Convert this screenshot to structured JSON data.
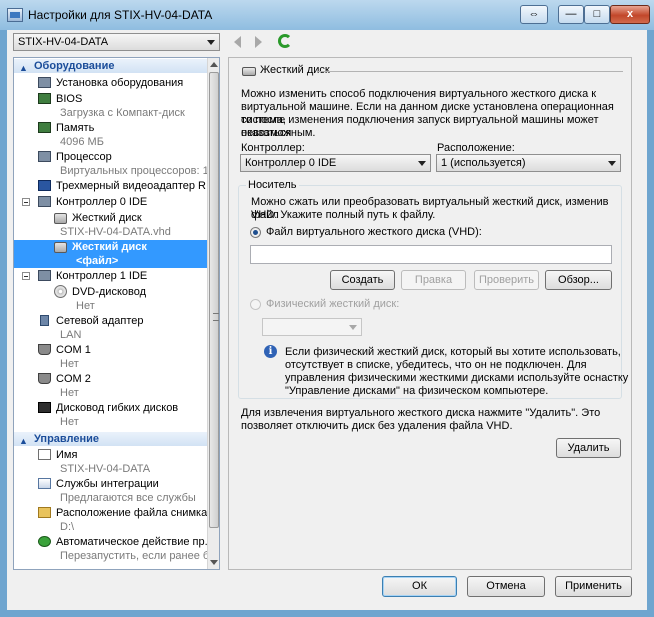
{
  "window": {
    "title": "Настройки для STIX-HV-04-DATA",
    "close_glyph": "x",
    "min_glyph": "—",
    "max_glyph": "□"
  },
  "vm_selector": {
    "value": "STIX-HV-04-DATA"
  },
  "tree": {
    "hardware_header": "Оборудование",
    "management_header": "Управление",
    "items": [
      {
        "label": "Установка оборудования",
        "sub": ""
      },
      {
        "label": "BIOS",
        "sub": "Загрузка с Компакт-диск"
      },
      {
        "label": "Память",
        "sub": "4096 МБ"
      },
      {
        "label": "Процессор",
        "sub": "Виртуальных процессоров: 1"
      },
      {
        "label": "Трехмерный видеоадаптер R...",
        "sub": ""
      },
      {
        "label": "Контроллер 0 IDE",
        "sub": ""
      },
      {
        "label": "Жесткий диск",
        "sub": "STIX-HV-04-DATA.vhd"
      },
      {
        "label": "Жесткий диск",
        "sub": "<файл>"
      },
      {
        "label": "Контроллер 1 IDE",
        "sub": ""
      },
      {
        "label": "DVD-дисковод",
        "sub": "Нет"
      },
      {
        "label": "Сетевой адаптер",
        "sub": "LAN"
      },
      {
        "label": "COM 1",
        "sub": "Нет"
      },
      {
        "label": "COM 2",
        "sub": "Нет"
      },
      {
        "label": "Дисковод гибких дисков",
        "sub": "Нет"
      }
    ],
    "mgmt_items": [
      {
        "label": "Имя",
        "sub": "STIX-HV-04-DATA"
      },
      {
        "label": "Службы интеграции",
        "sub": "Предлагаются все службы"
      },
      {
        "label": "Расположение файла снимка",
        "sub": "D:\\"
      },
      {
        "label": "Автоматическое действие пр...",
        "sub": "Перезапустить, если ранее б..."
      }
    ]
  },
  "panel": {
    "title": "Жесткий диск",
    "intro": [
      "Можно изменить способ подключения виртуального жесткого диска к",
      "виртуальной машине. Если на данном диске установлена операционная система,",
      "то после изменения подключения запуск виртуальной машины может оказаться",
      "невозможным."
    ],
    "controller_label": "Контроллер:",
    "controller_value": "Контроллер 0 IDE",
    "location_label": "Расположение:",
    "location_value": "1 (используется)",
    "media_label": "Носитель",
    "media_desc": [
      "Можно сжать или преобразовать виртуальный жесткий диск, изменив файл",
      "VHD. Укажите полный путь к файлу."
    ],
    "vhd_radio": "Файл виртуального жесткого диска (VHD):",
    "vhd_value": "",
    "btn_create": "Создать",
    "btn_edit": "Правка",
    "btn_inspect": "Проверить",
    "btn_browse": "Обзор...",
    "physical_radio": "Физический жесткий диск:",
    "info": [
      "Если физический жесткий диск, который вы хотите использовать,",
      "отсутствует в списке, убедитесь, что он не подключен. Для",
      "управления физическими жесткими дисками используйте оснастку",
      "\"Управление дисками\" на физическом компьютере."
    ],
    "remove_text": [
      "Для извлечения виртуального жесткого диска нажмите \"Удалить\". Это",
      "позволяет отключить диск без удаления файла VHD."
    ],
    "btn_remove": "Удалить"
  },
  "footer": {
    "ok": "ОК",
    "cancel": "Отмена",
    "apply": "Применить"
  }
}
